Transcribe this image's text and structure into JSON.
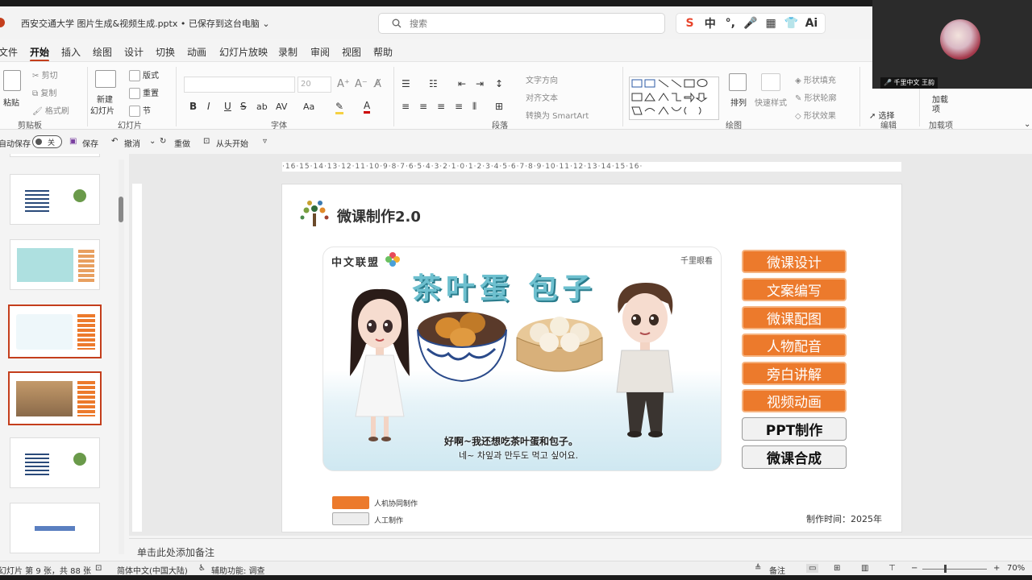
{
  "titlebar": {
    "doc_title": "西安交通大学 图片生成&视频生成.pptx • 已保存到这台电脑 ⌄",
    "search_placeholder": "搜索",
    "quick_icons": [
      "S",
      "中",
      "°,",
      "🎤",
      "▦",
      "👕",
      "Ai"
    ]
  },
  "menu": {
    "items": [
      {
        "label": "文件"
      },
      {
        "label": "开始"
      },
      {
        "label": "插入"
      },
      {
        "label": "绘图"
      },
      {
        "label": "设计"
      },
      {
        "label": "切换"
      },
      {
        "label": "动画"
      },
      {
        "label": "幻灯片放映"
      },
      {
        "label": "录制"
      },
      {
        "label": "审阅"
      },
      {
        "label": "视图"
      },
      {
        "label": "帮助"
      }
    ],
    "active": "开始"
  },
  "ribbon": {
    "clipboard": {
      "paste": "粘贴",
      "cut": "剪切",
      "copy": "复制",
      "format_painter": "格式刷",
      "label": "剪贴板"
    },
    "slides": {
      "new_slide": "新建",
      "new_slide2": "幻灯片",
      "layout": "版式",
      "reset": "重置",
      "section": "节",
      "label": "幻灯片"
    },
    "font": {
      "size": "20",
      "bold": "B",
      "italic": "I",
      "underline": "U",
      "strike": "S",
      "shadow": "ab",
      "label": "字体"
    },
    "paragraph": {
      "text_direction": "文字方向",
      "align_text": "对齐文本",
      "smartart": "转换为 SmartArt",
      "label": "段落"
    },
    "drawing": {
      "arrange": "排列",
      "quick_styles": "快速样式",
      "shape_fill": "形状填充",
      "shape_outline": "形状轮廓",
      "shape_effects": "形状效果",
      "label": "绘图"
    },
    "editing": {
      "select": "选择",
      "label": "编辑"
    },
    "addins": {
      "label": "加载项",
      "item": "加载项"
    }
  },
  "qat": {
    "autosave": "自动保存",
    "toggle_state": "关",
    "save": "保存",
    "undo": "撤消",
    "redo": "重做",
    "from_start": "从头开始"
  },
  "ruler": {
    "h": "·16·15·14·13·12·11·10·9·8·7·6·5·4·3·2·1·0·1·2·3·4·5·6·7·8·9·10·11·12·13·14·15·16·"
  },
  "slide": {
    "title": "微课制作2.0",
    "panel": {
      "title": "茶叶蛋 包子",
      "brand_left": "中文联盟",
      "brand_right": "千里眼看",
      "caption_cn": "好啊~我还想吃茶叶蛋和包子。",
      "caption_kr": "네~ 차잎과 만두도 먹고 싶어요."
    },
    "buttons": [
      {
        "label": "微课设计",
        "style": "orange"
      },
      {
        "label": "文案编写",
        "style": "orange"
      },
      {
        "label": "微课配图",
        "style": "orange"
      },
      {
        "label": "人物配音",
        "style": "orange"
      },
      {
        "label": "旁白讲解",
        "style": "orange"
      },
      {
        "label": "视频动画",
        "style": "orange"
      },
      {
        "label": "PPT制作",
        "style": "gray"
      },
      {
        "label": "微课合成",
        "style": "gray"
      }
    ],
    "legend": [
      {
        "label": "人机协同制作",
        "color": "#ec7a2c"
      },
      {
        "label": "人工制作",
        "color": "#ededed"
      }
    ],
    "credit": "制作时间：2025年"
  },
  "notes": {
    "placeholder": "单击此处添加备注"
  },
  "status": {
    "slide_info": "幻灯片 第 9 张，共 88 张",
    "language": "简体中文(中国大陆)",
    "accessibility": "辅助功能: 调查",
    "notes_btn": "备注",
    "zoom": "70%"
  },
  "video": {
    "name": "千里中文 王韵"
  }
}
